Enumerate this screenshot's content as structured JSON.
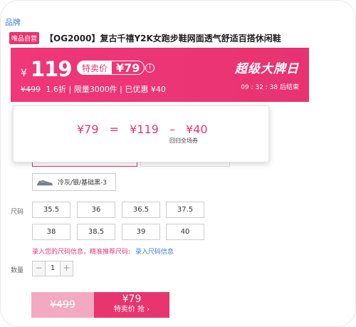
{
  "top_link": "品牌",
  "product": {
    "badge": "唯品自营",
    "title": "【OG2000】复古千禧Y2K女跑步鞋网面透气舒适百搭休闲鞋"
  },
  "price_banner": {
    "currency": "¥",
    "price": "119",
    "special_label": "特卖价",
    "special_value": "¥79",
    "original_price": "¥499",
    "sub_info": "1.6折 | 限量3000件 | 已优惠 ¥40",
    "event_title": "超级大牌日",
    "countdown": "09 : 32 : 38  后结束",
    "colors": {
      "accent": "#e8356f"
    }
  },
  "popup": {
    "left": "¥79",
    "eq": "=",
    "mid": "¥119",
    "minus": "–",
    "right": "¥40",
    "note": "回归全场券"
  },
  "row_labels": {
    "size": "尺码",
    "quantity": "数量"
  },
  "color_option": {
    "label": "冷灰/银/基础黑-3"
  },
  "sizes": [
    "35.5",
    "36",
    "36.5",
    "37.5",
    "38",
    "38.5",
    "39",
    "40"
  ],
  "hint": {
    "text": "录入您的尺码信息，精准推荐尺码:",
    "link": "录入尺码信息"
  },
  "quantity": {
    "minus": "−",
    "value": "1",
    "plus": "+"
  },
  "buy_bar": {
    "original_price": "¥499",
    "special_price": "¥79",
    "special_label": "特卖价 抢 ›"
  }
}
